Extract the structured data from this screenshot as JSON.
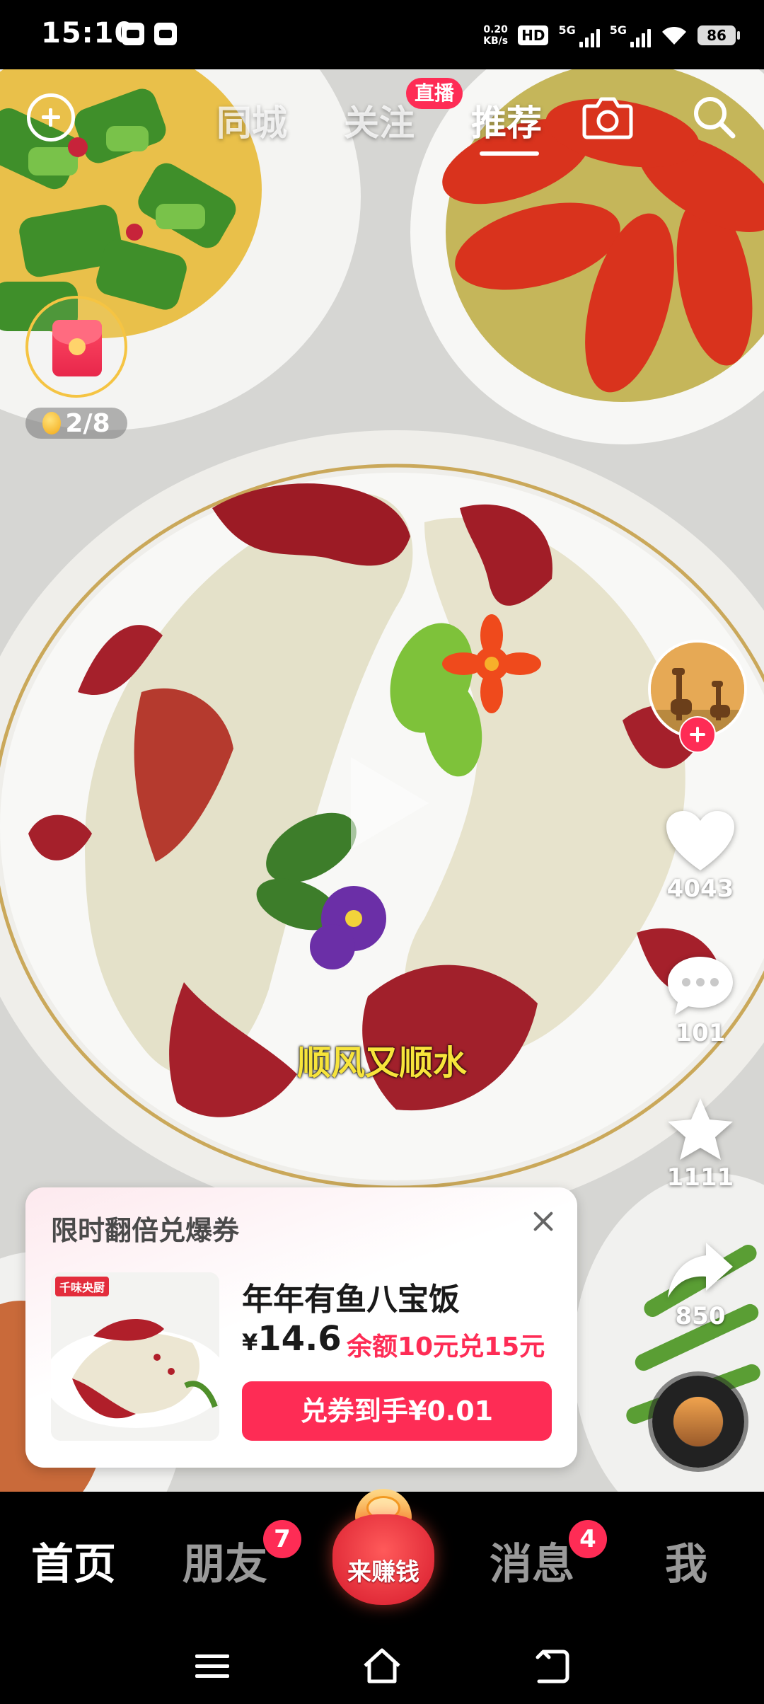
{
  "status_bar": {
    "time": "15:10",
    "net_speed_value": "0.20",
    "net_speed_unit": "KB/s",
    "hd_label": "HD",
    "sim1_label": "5G",
    "sim2_label": "5G",
    "battery": "86"
  },
  "top_nav": {
    "tabs": [
      {
        "label": "同城"
      },
      {
        "label": "关注"
      },
      {
        "label": "推荐"
      }
    ],
    "active_tab": "推荐",
    "live_badge": "直播"
  },
  "red_packet": {
    "progress_text": "2/8"
  },
  "video": {
    "caption": "顺风又顺水"
  },
  "actions": {
    "like_count": "4043",
    "comment_count": "101",
    "favorite_count": "1111",
    "share_count": "850"
  },
  "promo": {
    "title": "限时翻倍兑爆券",
    "brand_tag": "千味央厨",
    "product_name": "年年有鱼八宝饭",
    "currency": "¥",
    "price": "14.6",
    "offer": "余额10元兑15元",
    "cta": "兑券到手¥0.01"
  },
  "bottom_nav": {
    "items": [
      {
        "label": "首页"
      },
      {
        "label": "朋友",
        "badge": "7"
      },
      {
        "label": "来赚钱"
      },
      {
        "label": "消息",
        "badge": "4"
      },
      {
        "label": "我"
      }
    ]
  },
  "colors": {
    "accent": "#fe2c55",
    "caption": "#f7e43b",
    "coin": "#f5c443"
  }
}
